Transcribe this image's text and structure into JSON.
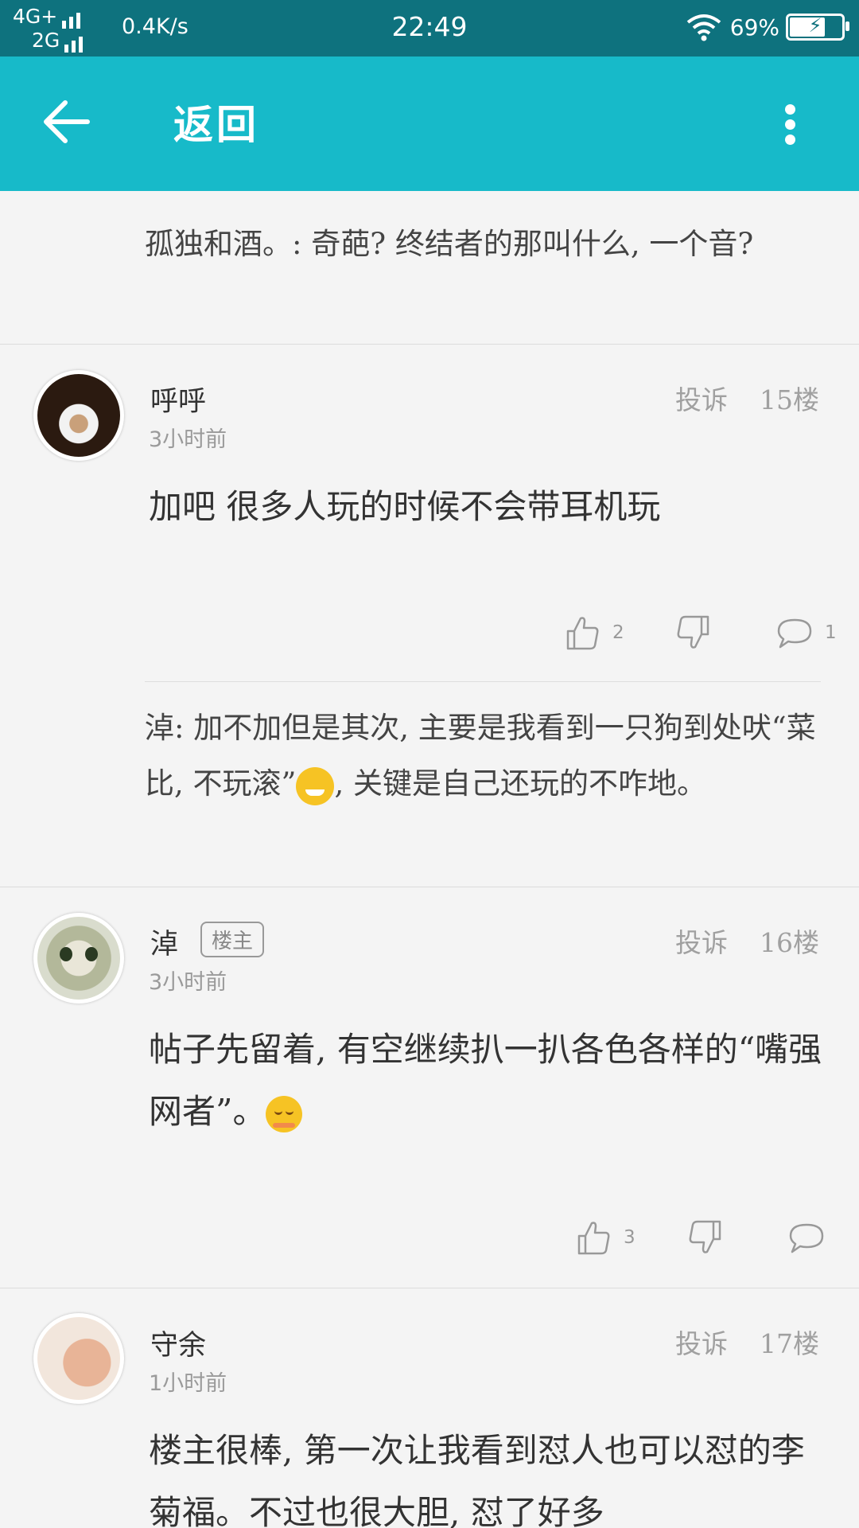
{
  "status_bar": {
    "network_top": "4G+",
    "network_bottom": "2G",
    "speed": "0.4K/s",
    "time": "22:49",
    "battery": "69%"
  },
  "app_bar": {
    "title": "返回"
  },
  "prev_reply": "孤独和酒。: 奇葩? 终结者的那叫什么, 一个音?",
  "comments": [
    {
      "username": "呼呼",
      "time": "3小时前",
      "report": "投诉",
      "floor": "15楼",
      "body": "加吧   很多人玩的时候不会带耳机玩",
      "likes": "2",
      "replies": "1",
      "reply_pre": "淖: 加不加但是其次, 主要是我看到一只狗到处吠“菜比, 不玩滚”",
      "reply_post": ", 关键是自己还玩的不咋地。"
    },
    {
      "username": "淖",
      "owner_badge": "楼主",
      "time": "3小时前",
      "report": "投诉",
      "floor": "16楼",
      "body": "帖子先留着, 有空继续扒一扒各色各样的“嘴强网者”。",
      "likes": "3"
    },
    {
      "username": "守余",
      "time": "1小时前",
      "report": "投诉",
      "floor": "17楼",
      "body": "楼主很棒, 第一次让我看到怼人也可以怼的李菊福。不过也很大胆, 怼了好多"
    }
  ],
  "colors": {
    "app_bar": "#17bac9",
    "status_bar": "#0e727e"
  }
}
